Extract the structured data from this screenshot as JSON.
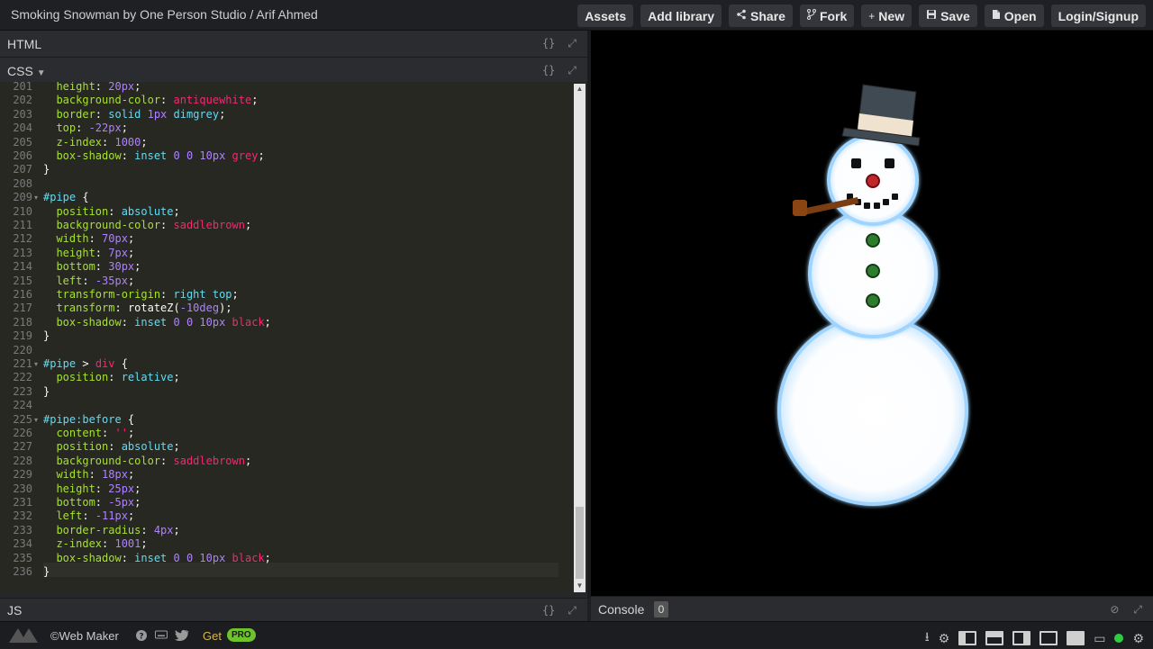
{
  "topbar": {
    "title": "Smoking Snowman by One Person Studio / Arif Ahmed",
    "buttons": [
      {
        "label": "Assets",
        "icon": ""
      },
      {
        "label": "Add library",
        "icon": ""
      },
      {
        "label": "Share",
        "icon": "share-icon"
      },
      {
        "label": "Fork",
        "icon": "fork-icon"
      },
      {
        "label": "New",
        "icon": "plus-icon"
      },
      {
        "label": "Save",
        "icon": "floppy-icon"
      },
      {
        "label": "Open",
        "icon": "document-icon"
      },
      {
        "label": "Login/Signup",
        "icon": ""
      }
    ]
  },
  "panes": {
    "html_label": "HTML",
    "css_label": "CSS",
    "js_label": "JS",
    "tool_braces": "{}",
    "tool_expand": "⤢"
  },
  "code": {
    "lines": [
      {
        "n": "201",
        "parts": [
          [
            "t-prop",
            "  height"
          ],
          [
            "t-colon",
            ": "
          ],
          [
            "t-num",
            "20px"
          ],
          [
            "t-plain",
            ";"
          ]
        ]
      },
      {
        "n": "202",
        "parts": [
          [
            "t-prop",
            "  background-color"
          ],
          [
            "t-colon",
            ": "
          ],
          [
            "t-str",
            "antiquewhite"
          ],
          [
            "t-plain",
            ";"
          ]
        ]
      },
      {
        "n": "203",
        "parts": [
          [
            "t-prop",
            "  border"
          ],
          [
            "t-colon",
            ": "
          ],
          [
            "t-kw",
            "solid "
          ],
          [
            "t-num",
            "1px "
          ],
          [
            "t-kw",
            "dimgrey"
          ],
          [
            "t-plain",
            ";"
          ]
        ]
      },
      {
        "n": "204",
        "parts": [
          [
            "t-prop",
            "  top"
          ],
          [
            "t-colon",
            ": "
          ],
          [
            "t-num",
            "-22px"
          ],
          [
            "t-plain",
            ";"
          ]
        ]
      },
      {
        "n": "205",
        "parts": [
          [
            "t-prop",
            "  z-index"
          ],
          [
            "t-colon",
            ": "
          ],
          [
            "t-num",
            "1000"
          ],
          [
            "t-plain",
            ";"
          ]
        ]
      },
      {
        "n": "206",
        "parts": [
          [
            "t-prop",
            "  box-shadow"
          ],
          [
            "t-colon",
            ": "
          ],
          [
            "t-kw",
            "inset "
          ],
          [
            "t-num",
            "0 0 10px "
          ],
          [
            "t-str",
            "grey"
          ],
          [
            "t-plain",
            ";"
          ]
        ]
      },
      {
        "n": "207",
        "parts": [
          [
            "t-plain",
            "}"
          ]
        ]
      },
      {
        "n": "208",
        "parts": []
      },
      {
        "n": "209",
        "parts": [
          [
            "t-sel",
            "#pipe"
          ],
          [
            "t-plain",
            " {"
          ]
        ],
        "fold": true
      },
      {
        "n": "210",
        "parts": [
          [
            "t-prop",
            "  position"
          ],
          [
            "t-colon",
            ": "
          ],
          [
            "t-kw",
            "absolute"
          ],
          [
            "t-plain",
            ";"
          ]
        ]
      },
      {
        "n": "211",
        "parts": [
          [
            "t-prop",
            "  background-color"
          ],
          [
            "t-colon",
            ": "
          ],
          [
            "t-str",
            "saddlebrown"
          ],
          [
            "t-plain",
            ";"
          ]
        ]
      },
      {
        "n": "212",
        "parts": [
          [
            "t-prop",
            "  width"
          ],
          [
            "t-colon",
            ": "
          ],
          [
            "t-num",
            "70px"
          ],
          [
            "t-plain",
            ";"
          ]
        ]
      },
      {
        "n": "213",
        "parts": [
          [
            "t-prop",
            "  height"
          ],
          [
            "t-colon",
            ": "
          ],
          [
            "t-num",
            "7px"
          ],
          [
            "t-plain",
            ";"
          ]
        ]
      },
      {
        "n": "214",
        "parts": [
          [
            "t-prop",
            "  bottom"
          ],
          [
            "t-colon",
            ": "
          ],
          [
            "t-num",
            "30px"
          ],
          [
            "t-plain",
            ";"
          ]
        ]
      },
      {
        "n": "215",
        "parts": [
          [
            "t-prop",
            "  left"
          ],
          [
            "t-colon",
            ": "
          ],
          [
            "t-num",
            "-35px"
          ],
          [
            "t-plain",
            ";"
          ]
        ]
      },
      {
        "n": "216",
        "parts": [
          [
            "t-prop",
            "  transform-origin"
          ],
          [
            "t-colon",
            ": "
          ],
          [
            "t-kw",
            "right top"
          ],
          [
            "t-plain",
            ";"
          ]
        ]
      },
      {
        "n": "217",
        "parts": [
          [
            "t-prop",
            "  transform"
          ],
          [
            "t-colon",
            ": "
          ],
          [
            "t-plain",
            "rotateZ("
          ],
          [
            "t-num",
            "-10deg"
          ],
          [
            "t-plain",
            ");"
          ]
        ]
      },
      {
        "n": "218",
        "parts": [
          [
            "t-prop",
            "  box-shadow"
          ],
          [
            "t-colon",
            ": "
          ],
          [
            "t-kw",
            "inset "
          ],
          [
            "t-num",
            "0 0 10px "
          ],
          [
            "t-str",
            "black"
          ],
          [
            "t-plain",
            ";"
          ]
        ]
      },
      {
        "n": "219",
        "parts": [
          [
            "t-plain",
            "}"
          ]
        ]
      },
      {
        "n": "220",
        "parts": []
      },
      {
        "n": "221",
        "parts": [
          [
            "t-sel",
            "#pipe"
          ],
          [
            "t-plain",
            " > "
          ],
          [
            "t-tag",
            "div"
          ],
          [
            "t-plain",
            " {"
          ]
        ],
        "fold": true
      },
      {
        "n": "222",
        "parts": [
          [
            "t-prop",
            "  position"
          ],
          [
            "t-colon",
            ": "
          ],
          [
            "t-kw",
            "relative"
          ],
          [
            "t-plain",
            ";"
          ]
        ]
      },
      {
        "n": "223",
        "parts": [
          [
            "t-plain",
            "}"
          ]
        ]
      },
      {
        "n": "224",
        "parts": []
      },
      {
        "n": "225",
        "parts": [
          [
            "t-sel",
            "#pipe:before"
          ],
          [
            "t-plain",
            " {"
          ]
        ],
        "fold": true
      },
      {
        "n": "226",
        "parts": [
          [
            "t-prop",
            "  content"
          ],
          [
            "t-colon",
            ": "
          ],
          [
            "t-str",
            "''"
          ],
          [
            "t-plain",
            ";"
          ]
        ]
      },
      {
        "n": "227",
        "parts": [
          [
            "t-prop",
            "  position"
          ],
          [
            "t-colon",
            ": "
          ],
          [
            "t-kw",
            "absolute"
          ],
          [
            "t-plain",
            ";"
          ]
        ]
      },
      {
        "n": "228",
        "parts": [
          [
            "t-prop",
            "  background-color"
          ],
          [
            "t-colon",
            ": "
          ],
          [
            "t-str",
            "saddlebrown"
          ],
          [
            "t-plain",
            ";"
          ]
        ]
      },
      {
        "n": "229",
        "parts": [
          [
            "t-prop",
            "  width"
          ],
          [
            "t-colon",
            ": "
          ],
          [
            "t-num",
            "18px"
          ],
          [
            "t-plain",
            ";"
          ]
        ]
      },
      {
        "n": "230",
        "parts": [
          [
            "t-prop",
            "  height"
          ],
          [
            "t-colon",
            ": "
          ],
          [
            "t-num",
            "25px"
          ],
          [
            "t-plain",
            ";"
          ]
        ]
      },
      {
        "n": "231",
        "parts": [
          [
            "t-prop",
            "  bottom"
          ],
          [
            "t-colon",
            ": "
          ],
          [
            "t-num",
            "-5px"
          ],
          [
            "t-plain",
            ";"
          ]
        ]
      },
      {
        "n": "232",
        "parts": [
          [
            "t-prop",
            "  left"
          ],
          [
            "t-colon",
            ": "
          ],
          [
            "t-num",
            "-11px"
          ],
          [
            "t-plain",
            ";"
          ]
        ]
      },
      {
        "n": "233",
        "parts": [
          [
            "t-prop",
            "  border-radius"
          ],
          [
            "t-colon",
            ": "
          ],
          [
            "t-num",
            "4px"
          ],
          [
            "t-plain",
            ";"
          ]
        ]
      },
      {
        "n": "234",
        "parts": [
          [
            "t-prop",
            "  z-index"
          ],
          [
            "t-colon",
            ": "
          ],
          [
            "t-num",
            "1001"
          ],
          [
            "t-plain",
            ";"
          ]
        ]
      },
      {
        "n": "235",
        "parts": [
          [
            "t-prop",
            "  box-shadow"
          ],
          [
            "t-colon",
            ": "
          ],
          [
            "t-kw",
            "inset "
          ],
          [
            "t-num",
            "0 0 10px "
          ],
          [
            "t-str",
            "black"
          ],
          [
            "t-plain",
            ";"
          ]
        ]
      },
      {
        "n": "236",
        "parts": [
          [
            "t-plain",
            "}"
          ]
        ]
      }
    ]
  },
  "console": {
    "label": "Console",
    "count": "0"
  },
  "footer": {
    "brand": "©Web Maker",
    "get": "Get",
    "pro": "PRO"
  },
  "colors": {
    "accent_green": "#6ec22b",
    "editor_bg": "#272822",
    "preview_bg": "#000000"
  }
}
